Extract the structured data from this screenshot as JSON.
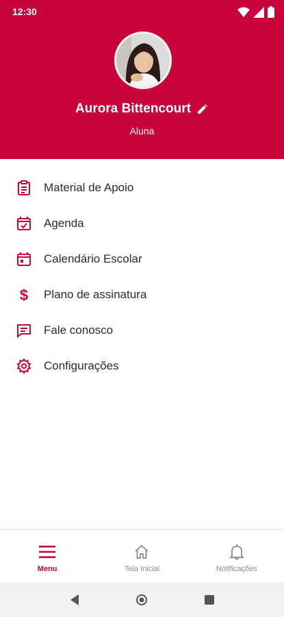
{
  "status_bar": {
    "time": "12:30",
    "icons": [
      "wifi-icon",
      "signal-icon",
      "battery-icon"
    ]
  },
  "profile": {
    "name": "Aurora Bittencourt",
    "role": "Aluna",
    "avatar": "profile-photo",
    "edit_icon": "pencil-icon"
  },
  "menu": {
    "items": [
      {
        "label": "Material de Apoio",
        "icon": "clipboard-icon"
      },
      {
        "label": "Agenda",
        "icon": "calendar-check-icon"
      },
      {
        "label": "Calendário Escolar",
        "icon": "calendar-icon"
      },
      {
        "label": "Plano de assinatura",
        "icon": "dollar-icon"
      },
      {
        "label": "Fale conosco",
        "icon": "chat-icon"
      },
      {
        "label": "Configurações",
        "icon": "gear-icon"
      }
    ]
  },
  "bottom_nav": {
    "items": [
      {
        "label": "Menu",
        "icon": "hamburger-icon",
        "active": true
      },
      {
        "label": "Tela Inicial",
        "icon": "home-icon",
        "active": false
      },
      {
        "label": "Notificações",
        "icon": "bell-icon",
        "active": false
      }
    ]
  },
  "system_nav": [
    "back-icon",
    "home-circle-icon",
    "recents-icon"
  ],
  "colors": {
    "primary": "#c8043b",
    "text": "#2b2b2b",
    "inactive": "#8a8a8a"
  }
}
